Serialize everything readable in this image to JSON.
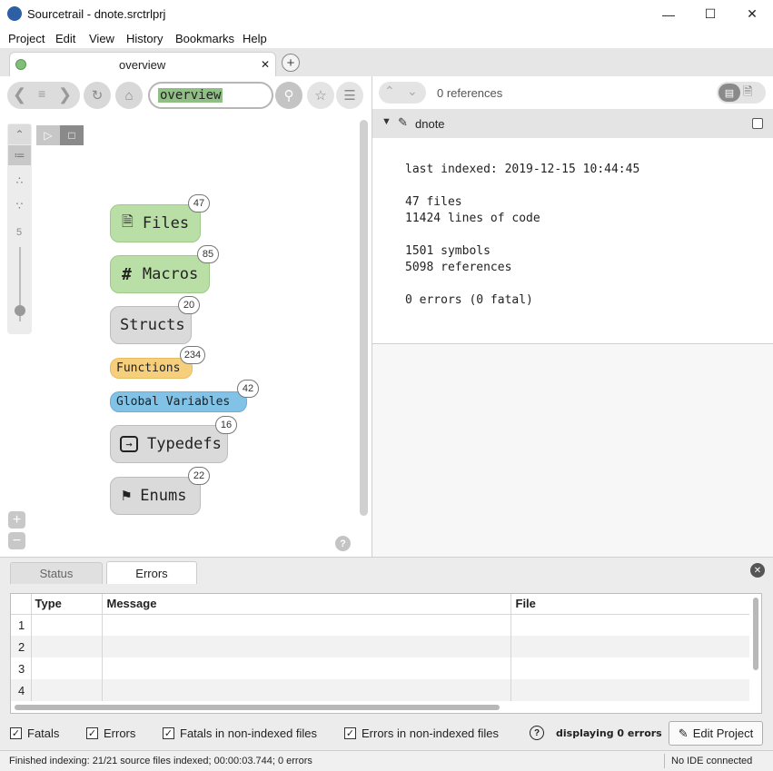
{
  "window": {
    "title": "Sourcetrail - dnote.srctrlprj",
    "minimize": "—",
    "maximize": "☐",
    "close": "✕"
  },
  "menu": [
    "Project",
    "Edit",
    "View",
    "History",
    "Bookmarks",
    "Help"
  ],
  "tab": {
    "label": "overview",
    "close": "✕",
    "new": "+"
  },
  "search": {
    "value": "overview"
  },
  "references": {
    "count_label": "0 references"
  },
  "graph": {
    "depth": "5",
    "nodes": [
      {
        "label": "Files",
        "count": "47"
      },
      {
        "label": "Macros",
        "count": "85"
      },
      {
        "label": "Structs",
        "count": "20"
      },
      {
        "label": "Functions",
        "count": "234"
      },
      {
        "label": "Global Variables",
        "count": "42"
      },
      {
        "label": "Typedefs",
        "count": "16"
      },
      {
        "label": "Enums",
        "count": "22"
      }
    ],
    "help": "?"
  },
  "code": {
    "file": "dnote",
    "lines": [
      "last indexed: 2019-12-15 10:44:45",
      "47 files",
      "11424 lines of code",
      "1501 symbols",
      "5098 references",
      "0 errors (0 fatal)"
    ]
  },
  "bottom": {
    "tabs": [
      "Status",
      "Errors"
    ],
    "columns": [
      "Type",
      "Message",
      "File"
    ],
    "rows": [
      "1",
      "2",
      "3",
      "4"
    ],
    "filters": [
      "Fatals",
      "Errors",
      "Fatals in non-indexed files",
      "Errors in non-indexed files"
    ],
    "displaying": "displaying 0 errors",
    "edit_project": "Edit Project",
    "help": "?"
  },
  "status": {
    "message": "Finished indexing: 21/21 source files indexed; 00:00:03.744; 0 errors",
    "ide": "No IDE connected"
  },
  "colors": {
    "files": "#b9dfa6",
    "macros": "#b9dfa6",
    "functions": "#f6cf7c",
    "globals": "#82c2e6",
    "gray": "#dadada",
    "search_highlight": "#8fbf85"
  }
}
